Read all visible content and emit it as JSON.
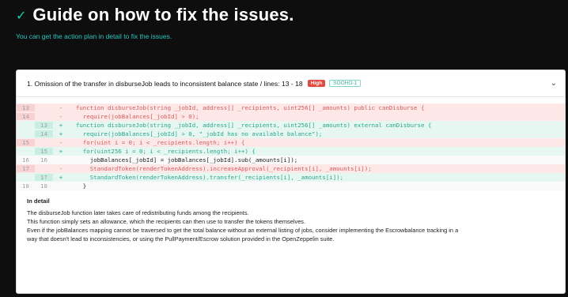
{
  "header": {
    "title": "Guide on how to fix the issues.",
    "subtitle": "You can get the action plan in detail to fix the issues."
  },
  "issue": {
    "title": "1. Omission of the transfer in disburseJob leads to inconsistent balance state / lines: 13 - 18",
    "severity": "High",
    "code_id": "SOOHO-1"
  },
  "code_lines": [
    {
      "old": "13",
      "new": "",
      "sign": "-",
      "type": "del",
      "text": "  function disburseJob(string _jobId, address[] _recipients, uint256[] _amounts) public canDisburse {"
    },
    {
      "old": "14",
      "new": "",
      "sign": "-",
      "type": "del",
      "text": "    require(jobBalances[_jobId] > 0);"
    },
    {
      "old": "",
      "new": "13",
      "sign": "+",
      "type": "add",
      "text": "  function disburseJob(string _jobId, address[] _recipients, uint256[] _amounts) external canDisburse {"
    },
    {
      "old": "",
      "new": "14",
      "sign": "+",
      "type": "add",
      "text": "    require(jobBalances[_jobId] > 0, \"_jobId has no available balance\");"
    },
    {
      "old": "15",
      "new": "",
      "sign": "-",
      "type": "del",
      "text": "    for(uint i = 0; i < _recipients.length; i++) {"
    },
    {
      "old": "",
      "new": "15",
      "sign": "+",
      "type": "add",
      "text": "    for(uint256 i = 0; i < _recipients.length; i++) {"
    },
    {
      "old": "16",
      "new": "16",
      "sign": "",
      "type": "ctx",
      "text": "      jobBalances[_jobId] = jobBalances[_jobId].sub(_amounts[i]);"
    },
    {
      "old": "17",
      "new": "",
      "sign": "-",
      "type": "del",
      "text": "      StandardToken(renderTokenAddress).increaseApproval(_recipients[i], _amounts[i]);"
    },
    {
      "old": "",
      "new": "17",
      "sign": "+",
      "type": "add",
      "text": "      StandardToken(renderTokenAddress).transfer(_recipients[i], _amounts[i]);"
    },
    {
      "old": "18",
      "new": "18",
      "sign": "",
      "type": "ctx",
      "text": "    }"
    }
  ],
  "detail": {
    "heading": "In detail",
    "lines": [
      "The disburseJob function later takes care of redistributing funds among the recipients.",
      "This function simply sets an allowance, which the recipients can then use to transfer the tokens themselves.",
      "Even if the jobBalances mapping cannot be traversed to get the total balance without an external listing of jobs, consider implementing the Escrowbalance tracking in a",
      "way that doesn't lead to inconsistencies, or using the PullPayment/Escrow solution provided in the OpenZeppelin suite."
    ]
  },
  "icons": {
    "check": "check-icon",
    "chevron": "chevron-down-icon"
  },
  "colors": {
    "accent": "#1fd0b0",
    "high": "#e34b3f",
    "del_bg": "#fde7e7",
    "add_bg": "#e6f7f2"
  }
}
